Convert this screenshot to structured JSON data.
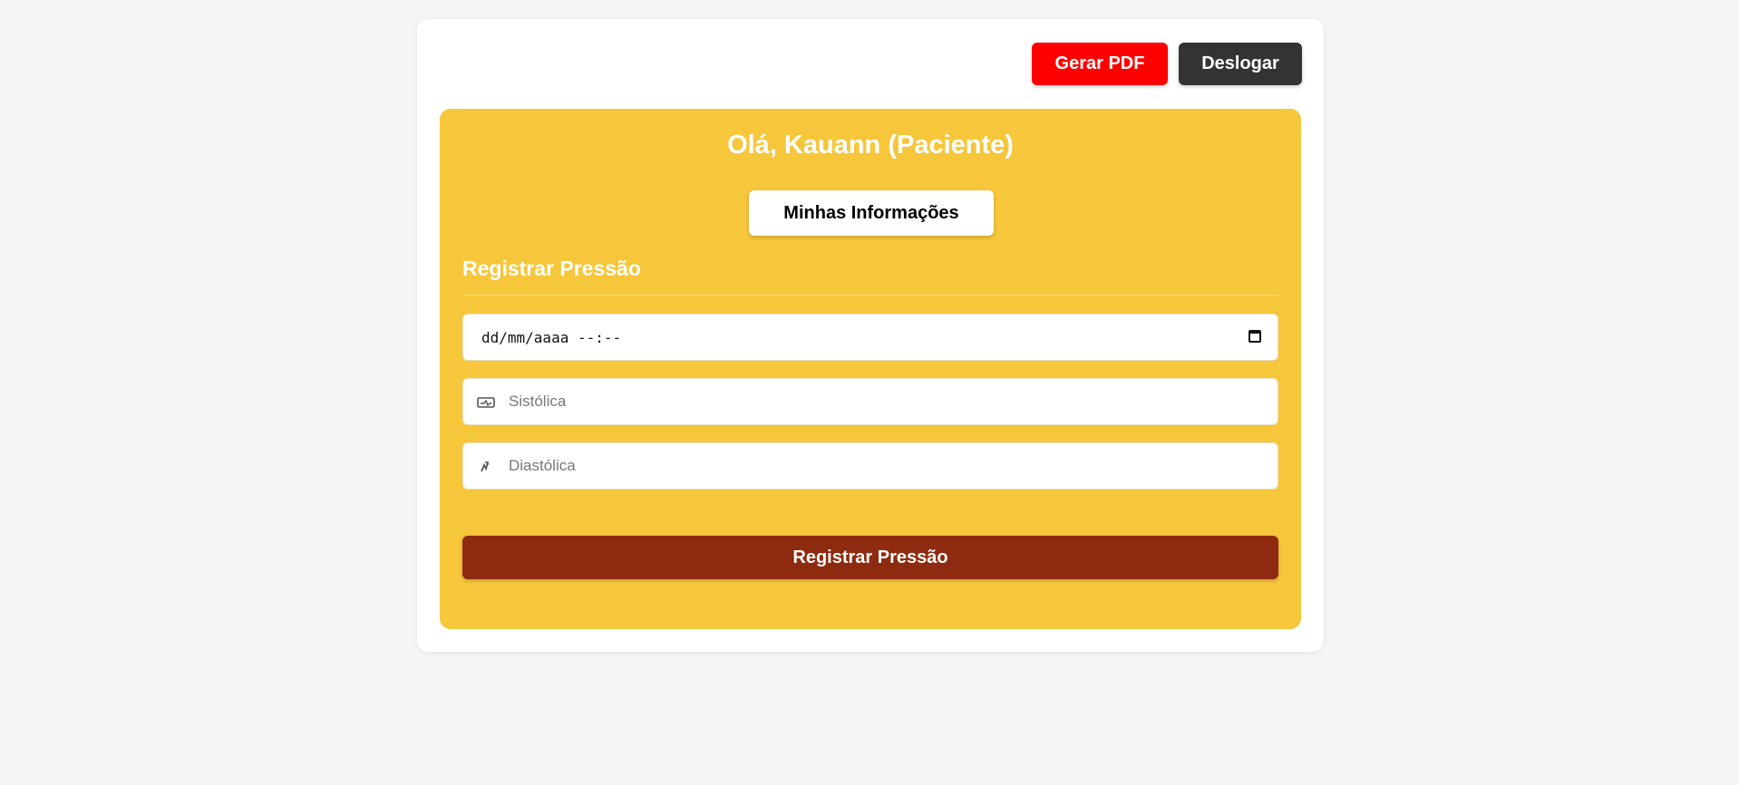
{
  "toolbar": {
    "pdf_label": "Gerar PDF",
    "logout_label": "Deslogar"
  },
  "panel": {
    "greeting": "Olá, Kauann (Paciente)",
    "info_button": "Minhas Informações",
    "section_title": "Registrar Pressão",
    "date_field": {
      "value_display": "dd/mm/aaaa --:--",
      "icon": "calendar-icon"
    },
    "systolic_field": {
      "placeholder": "Sistólica",
      "icon": "monitor-icon"
    },
    "diastolic_field": {
      "placeholder": "Diastólica",
      "icon": "pulse-icon"
    },
    "submit_label": "Registrar Pressão"
  },
  "colors": {
    "page_bg": "#f5f5f5",
    "panel_bg": "#f6c63b",
    "pdf_button": "#ff0000",
    "logout_button": "#333333",
    "submit_button": "#8d2a10"
  }
}
